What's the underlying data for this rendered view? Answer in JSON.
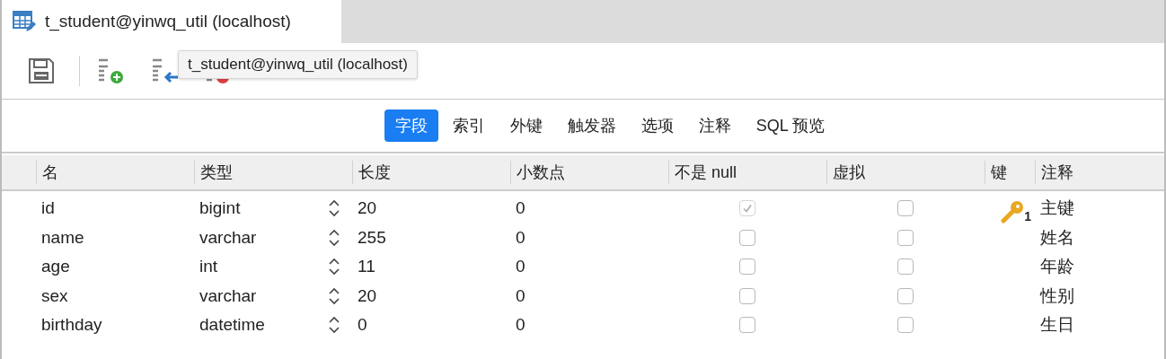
{
  "window": {
    "tab_title": "t_student@yinwq_util (localhost)"
  },
  "tooltip": "t_student@yinwq_util (localhost)",
  "tabs": [
    {
      "label": "字段",
      "selected": true
    },
    {
      "label": "索引",
      "selected": false
    },
    {
      "label": "外键",
      "selected": false
    },
    {
      "label": "触发器",
      "selected": false
    },
    {
      "label": "选项",
      "selected": false
    },
    {
      "label": "注释",
      "selected": false
    },
    {
      "label": "SQL 预览",
      "selected": false
    }
  ],
  "table": {
    "columns": [
      "名",
      "类型",
      "长度",
      "小数点",
      "不是 null",
      "虚拟",
      "键",
      "注释"
    ],
    "rows": [
      {
        "name": "id",
        "type": "bigint",
        "length": "20",
        "decimals": "0",
        "not_null": true,
        "not_null_disabled": true,
        "virtual": false,
        "primary_key": true,
        "key_order": "1",
        "comment": "主键"
      },
      {
        "name": "name",
        "type": "varchar",
        "length": "255",
        "decimals": "0",
        "not_null": false,
        "not_null_disabled": false,
        "virtual": false,
        "primary_key": false,
        "comment": "姓名"
      },
      {
        "name": "age",
        "type": "int",
        "length": "11",
        "decimals": "0",
        "not_null": false,
        "not_null_disabled": false,
        "virtual": false,
        "primary_key": false,
        "comment": "年龄"
      },
      {
        "name": "sex",
        "type": "varchar",
        "length": "20",
        "decimals": "0",
        "not_null": false,
        "not_null_disabled": false,
        "virtual": false,
        "primary_key": false,
        "comment": "性别"
      },
      {
        "name": "birthday",
        "type": "datetime",
        "length": "0",
        "decimals": "0",
        "not_null": false,
        "not_null_disabled": false,
        "virtual": false,
        "primary_key": false,
        "comment": "生日"
      }
    ]
  }
}
